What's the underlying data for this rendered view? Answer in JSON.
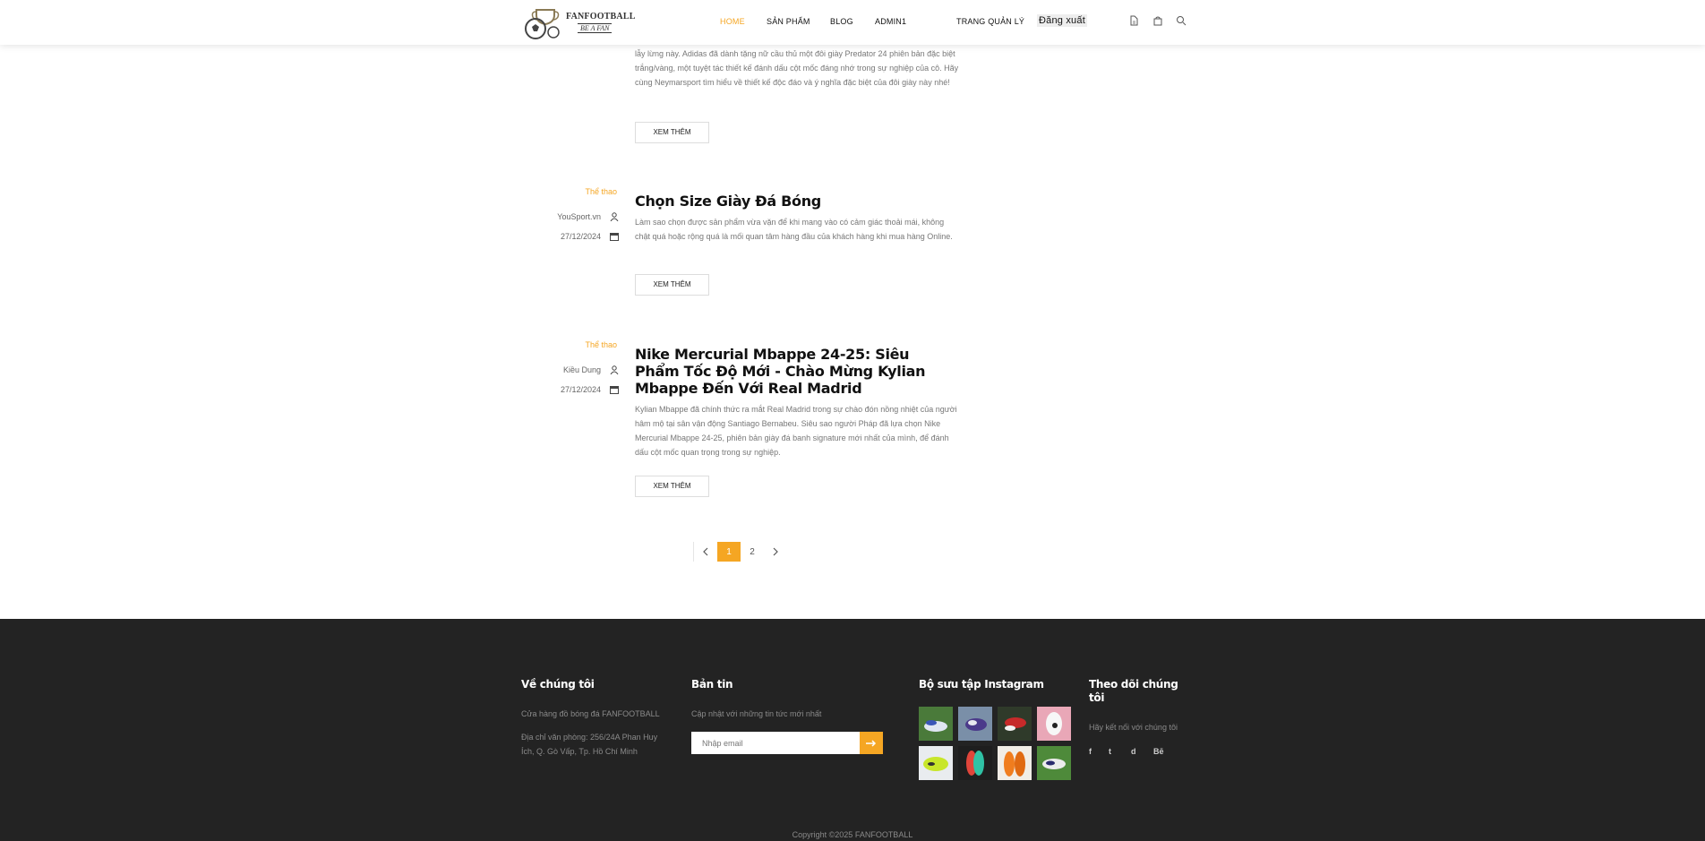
{
  "header": {
    "logo_text": "FANFOOTBALL",
    "logo_sub": "BE A FAN",
    "nav": [
      "HOME",
      "SẢN PHẨM",
      "BLOG",
      "ADMIN1",
      "TRANG QUẢN LÝ"
    ],
    "logout": "Đăng xuất",
    "icons": [
      "document-icon",
      "cart-icon",
      "search-icon"
    ]
  },
  "posts": [
    {
      "excerpt_partial": "lẫy lừng này. Adidas đã dành tặng nữ cầu thủ một đôi giày Predator 24 phiên bản đặc biệt trắng/vàng, một tuyệt tác thiết kế đánh dấu cột mốc đáng nhớ trong sự nghiệp của cô. Hãy cùng Neymarsport tìm hiểu về thiết kế độc đáo và ý nghĩa đặc biệt của đôi giày này nhé!",
      "more": "XEM THÊM"
    },
    {
      "category": "Thể thao",
      "author": "YouSport.vn",
      "date": "27/12/2024",
      "title": "Chọn Size Giày Đá Bóng",
      "excerpt": "Làm sao chọn được sản phẩm vừa vặn để khi mang vào có cảm giác thoải mái, không chật quá hoặc rộng quá là mối quan tâm hàng đầu của khách hàng khi mua hàng Online.",
      "more": "XEM THÊM"
    },
    {
      "category": "Thể thao",
      "author": "Kiều Dung",
      "date": "27/12/2024",
      "title": "Nike Mercurial Mbappe 24-25: Siêu Phẩm Tốc Độ Mới - Chào Mừng Kylian Mbappe Đến Với Real Madrid",
      "excerpt": "Kylian Mbappe đã chính thức ra mắt Real Madrid trong sự chào đón nồng nhiệt của người hâm mộ tại sân vận động Santiago Bernabeu. Siêu sao người Pháp đã lựa chọn Nike Mercurial Mbappe 24-25, phiên bản giày đá banh signature mới nhất của mình, để đánh dấu cột mốc quan trọng trong sự nghiệp.",
      "more": "XEM THÊM"
    }
  ],
  "pagination": {
    "pages": [
      "1",
      "2"
    ],
    "current": "1"
  },
  "footer": {
    "about_title": "Về chúng tôi",
    "about_text": "Cửa hàng đồ bóng đá FANFOOTBALL",
    "address": "Địa chỉ văn phòng: 256/24A Phan Huy Ích, Q. Gò Vấp, Tp. Hồ Chí Minh",
    "newsletter_title": "Bản tin",
    "newsletter_text": "Cập nhật với những tin tức mới nhất",
    "newsletter_placeholder": "Nhập email",
    "instagram_title": "Bộ sưu tập Instagram",
    "follow_title": "Theo dõi chúng tôi",
    "follow_text": "Hãy kết nối với chúng tôi",
    "social": [
      "f",
      "t",
      "d",
      "Bē"
    ],
    "copyright": "Copyright ©2025 FANFOOTBALL"
  },
  "colors": {
    "accent": "#f5a623",
    "footer_bg": "#232323"
  }
}
